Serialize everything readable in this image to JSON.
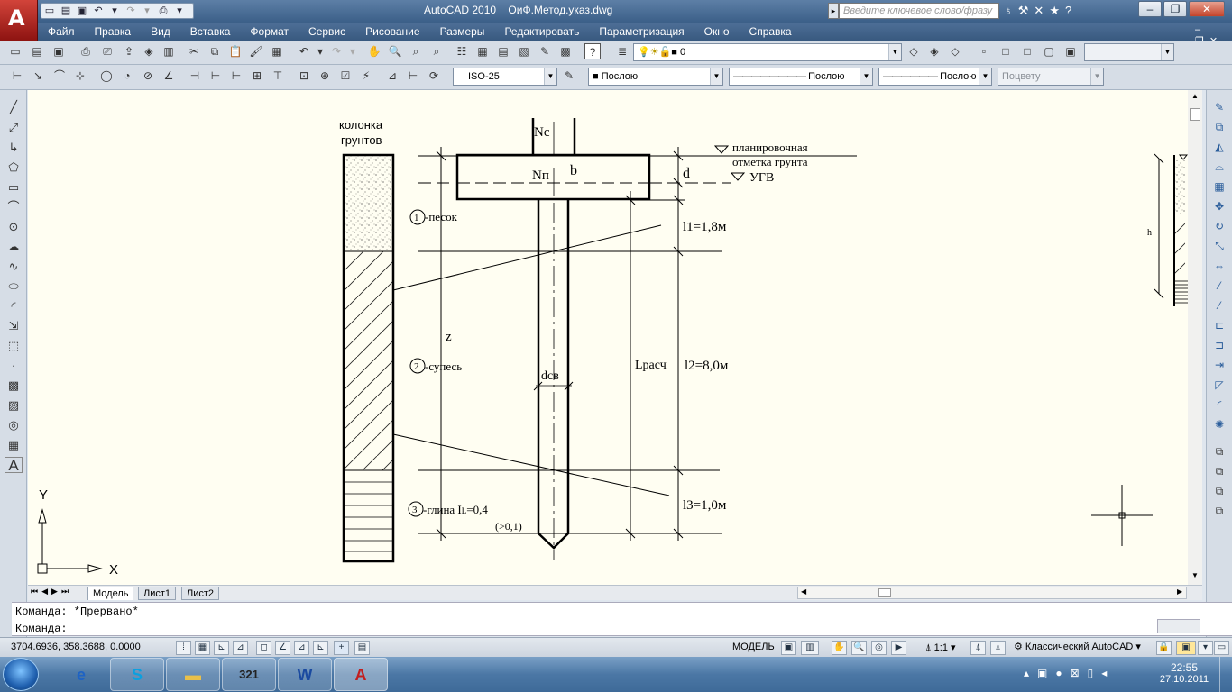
{
  "app": {
    "title": "AutoCAD 2010",
    "filename": "ОиФ.Метод.указ.dwg",
    "search_placeholder": "Введите ключевое слово/фразу",
    "logo_letter": "A"
  },
  "menu": [
    "Файл",
    "Правка",
    "Вид",
    "Вставка",
    "Формат",
    "Сервис",
    "Рисование",
    "Размеры",
    "Редактировать",
    "Параметризация",
    "Окно",
    "Справка"
  ],
  "toolbar2": {
    "layer_value": "0"
  },
  "toolbar3": {
    "dimstyle": "ISO-25",
    "color": "Послою",
    "linetype": "Послою",
    "lineweight": "Послою",
    "plotstyle": "Поцвету"
  },
  "drawing": {
    "column_title_1": "колонка",
    "column_title_2": "грунтов",
    "nc": "Nc",
    "np": "Nп",
    "b": "b",
    "d": "d",
    "planning_1": "планировочная",
    "planning_2": "отметка грунта",
    "ugv": "УГВ",
    "layer1_num": "1",
    "layer1": "-песок",
    "layer2_num": "2",
    "layer2": "-супесь",
    "layer3_num": "3",
    "layer3": "-глина I",
    "layer3_sub": "L",
    "layer3_val": "=0,4",
    "layer3_note": "(>0,1)",
    "l1": "l1=1,8м",
    "l2": "l2=8,0м",
    "l3": "l3=1,0м",
    "z": "z",
    "dsv": "dсв",
    "lrasch": "Lрасч",
    "h": "h"
  },
  "ucs": {
    "y": "Y",
    "x": "X"
  },
  "tabs": [
    "Модель",
    "Лист1",
    "Лист2"
  ],
  "command": {
    "line1": "Команда: *Прервано*",
    "line2": "Команда:"
  },
  "status": {
    "coords": "3704.6936, 358.3688, 0.0000",
    "model": "МОДЕЛЬ",
    "scale": "1:1",
    "workspace": "Классический AutoCAD"
  },
  "taskbar": {
    "time": "22:55",
    "date": "27.10.2011"
  }
}
